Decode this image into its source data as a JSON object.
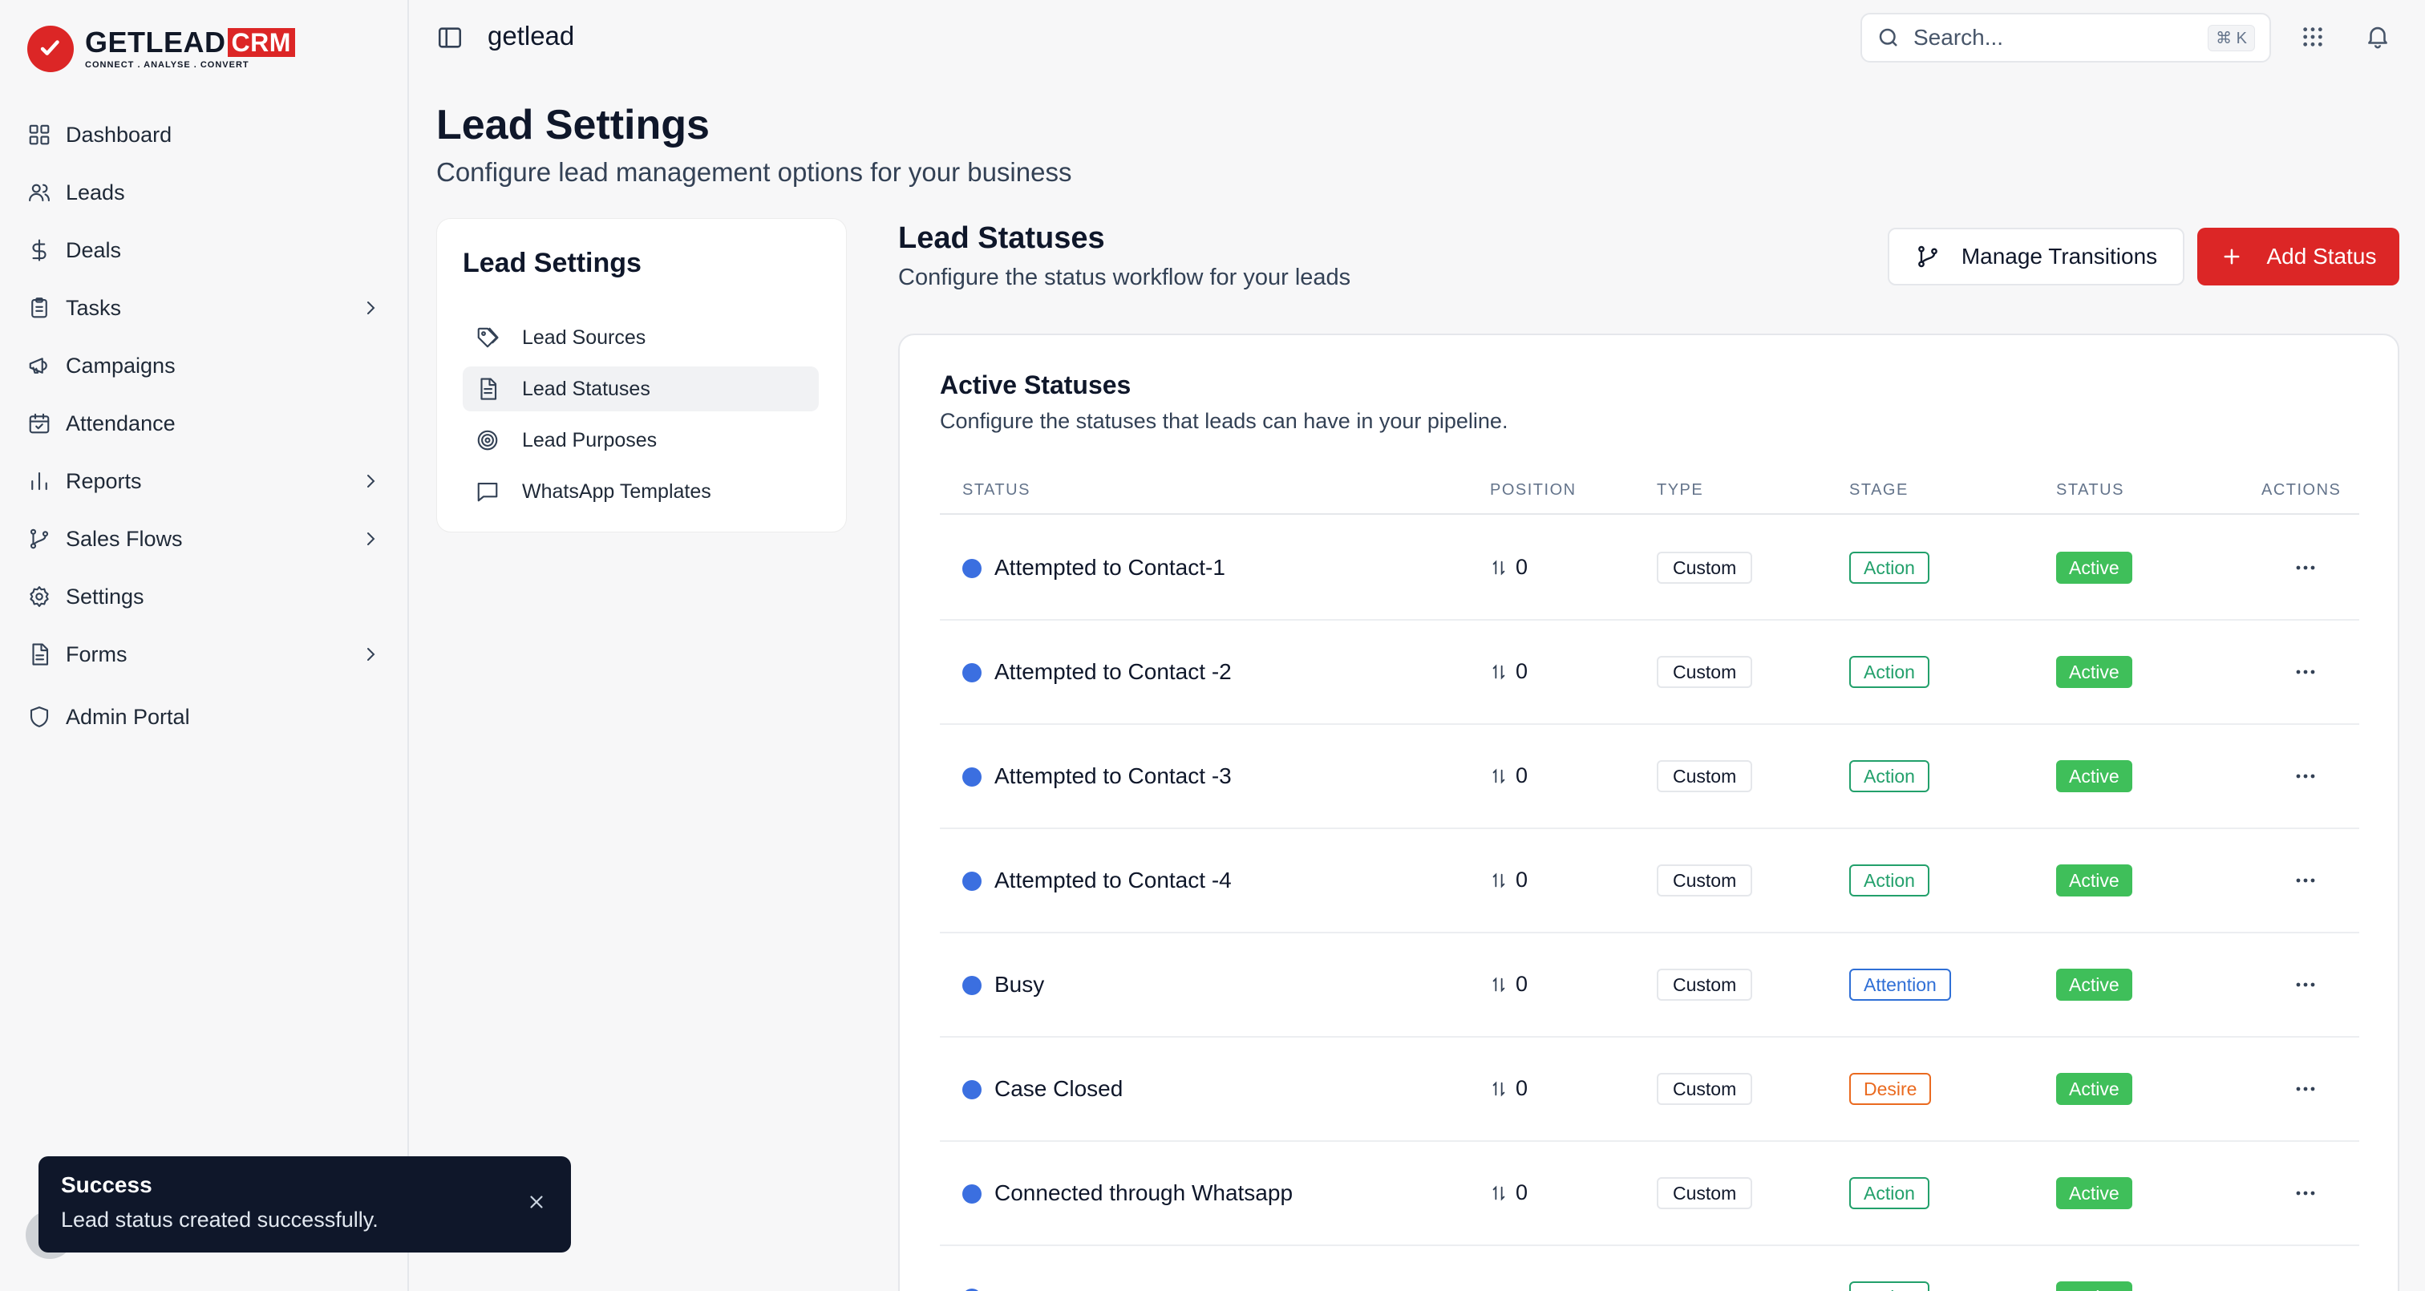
{
  "brand": {
    "name": "GETLEAD",
    "suffix": "CRM",
    "tagline": "CONNECT . ANALYSE . CONVERT",
    "accent": "#dc2626"
  },
  "sidebar": {
    "items": [
      {
        "label": "Dashboard",
        "icon": "grid-icon",
        "has_chevron": false
      },
      {
        "label": "Leads",
        "icon": "users-icon",
        "has_chevron": false
      },
      {
        "label": "Deals",
        "icon": "dollar-icon",
        "has_chevron": false
      },
      {
        "label": "Tasks",
        "icon": "clipboard-icon",
        "has_chevron": true
      },
      {
        "label": "Campaigns",
        "icon": "megaphone-icon",
        "has_chevron": false
      },
      {
        "label": "Attendance",
        "icon": "calendar-check-icon",
        "has_chevron": false
      },
      {
        "label": "Reports",
        "icon": "bar-chart-icon",
        "has_chevron": true
      },
      {
        "label": "Sales Flows",
        "icon": "git-branch-icon",
        "has_chevron": true
      },
      {
        "label": "Settings",
        "icon": "gear-icon",
        "has_chevron": false
      },
      {
        "label": "Forms",
        "icon": "file-text-icon",
        "has_chevron": true
      },
      {
        "label": "Admin Portal",
        "icon": "shield-icon",
        "has_chevron": false
      }
    ]
  },
  "topbar": {
    "workspace": "getlead",
    "search_placeholder": "Search...",
    "search_shortcut": "⌘ K"
  },
  "page": {
    "title": "Lead Settings",
    "subtitle": "Configure lead management options for your business"
  },
  "settings_nav": {
    "title": "Lead Settings",
    "items": [
      {
        "label": "Lead Sources",
        "icon": "tag-icon",
        "active": false
      },
      {
        "label": "Lead Statuses",
        "icon": "file-icon",
        "active": true
      },
      {
        "label": "Lead Purposes",
        "icon": "target-icon",
        "active": false
      },
      {
        "label": "WhatsApp Templates",
        "icon": "message-square-icon",
        "active": false
      }
    ]
  },
  "section": {
    "title": "Lead Statuses",
    "subtitle": "Configure the status workflow for your leads",
    "manage_button": "Manage Transitions",
    "add_button": "Add Status"
  },
  "table": {
    "title": "Active Statuses",
    "subtitle": "Configure the statuses that leads can have in your pipeline.",
    "columns": [
      "STATUS",
      "POSITION",
      "TYPE",
      "STAGE",
      "STATUS",
      "ACTIONS"
    ],
    "rows": [
      {
        "name": "Attempted to Contact-1",
        "position": "0",
        "type": "Custom",
        "stage": "Action",
        "status": "Active"
      },
      {
        "name": "Attempted to Contact -2",
        "position": "0",
        "type": "Custom",
        "stage": "Action",
        "status": "Active"
      },
      {
        "name": "Attempted to Contact -3",
        "position": "0",
        "type": "Custom",
        "stage": "Action",
        "status": "Active"
      },
      {
        "name": "Attempted to Contact -4",
        "position": "0",
        "type": "Custom",
        "stage": "Action",
        "status": "Active"
      },
      {
        "name": "Busy",
        "position": "0",
        "type": "Custom",
        "stage": "Attention",
        "status": "Active"
      },
      {
        "name": "Case Closed",
        "position": "0",
        "type": "Custom",
        "stage": "Desire",
        "status": "Active"
      },
      {
        "name": "Connected through Whatsapp",
        "position": "0",
        "type": "Custom",
        "stage": "Action",
        "status": "Active"
      },
      {
        "name": "",
        "position": "",
        "type": "",
        "stage": "Action",
        "status": "Active"
      }
    ],
    "stage_colors": {
      "Action": "#22a06b",
      "Attention": "#2f6fd6",
      "Desire": "#ea6a1f"
    },
    "status_color": "#3fbf5a",
    "dot_color": "#3b6fe0"
  },
  "toast": {
    "title": "Success",
    "message": "Lead status created successfully."
  }
}
